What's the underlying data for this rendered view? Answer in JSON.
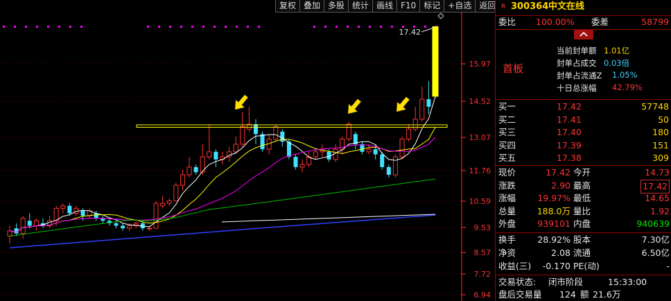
{
  "toolbar": {
    "buttons": [
      "复权",
      "叠加",
      "多股",
      "统计",
      "画线",
      "F10",
      "标记",
      "+自选",
      "返回"
    ]
  },
  "chart": {
    "price_labels": [
      "15.97",
      "14.52",
      "13.07",
      "11.76",
      "10.59",
      "9.53",
      "8.57",
      "7.72",
      "6.94"
    ],
    "last_price_label": "17.42",
    "axis_color": "#ff3030",
    "up_color": "#ff3232",
    "down_color": "#40e0ff",
    "limit_up_color": "#ffff00"
  },
  "quote": {
    "badge": "R",
    "code": "300364",
    "name": "中文在线",
    "weibi_label": "委比",
    "weibi_value": "100.00%",
    "weicha_label": "委差",
    "weicha_value": "58799",
    "shoubanc_label": "首板",
    "seal_stats": [
      {
        "label": "当前封单额",
        "value": "1.01亿"
      },
      {
        "label": "封单占成交",
        "value": "0.03倍"
      },
      {
        "label": "封单占流通Z",
        "value": "1.05%"
      },
      {
        "label": "十日总涨幅",
        "value": "42.79%"
      }
    ],
    "bids": [
      {
        "label": "买一",
        "price": "17.42",
        "vol": "57748"
      },
      {
        "label": "买二",
        "price": "17.41",
        "vol": "50"
      },
      {
        "label": "买三",
        "price": "17.40",
        "vol": "180"
      },
      {
        "label": "买四",
        "price": "17.39",
        "vol": "151"
      },
      {
        "label": "买五",
        "price": "17.38",
        "vol": "309"
      }
    ],
    "stats": [
      {
        "l1": "现价",
        "v1": "17.42",
        "c1": "red",
        "l2": "今开",
        "v2": "14.73",
        "c2": "red"
      },
      {
        "l1": "涨跌",
        "v1": "2.90",
        "c1": "red",
        "l2": "最高",
        "v2": "17.42",
        "c2": "red"
      },
      {
        "l1": "涨幅",
        "v1": "19.97%",
        "c1": "red",
        "l2": "最低",
        "v2": "14.65",
        "c2": "red"
      },
      {
        "l1": "总量",
        "v1": "188.0万",
        "c1": "yellow",
        "l2": "量比",
        "v2": "1.92",
        "c2": "red"
      },
      {
        "l1": "外盘",
        "v1": "939101",
        "c1": "red",
        "l2": "内盘",
        "v2": "940639",
        "c2": "green"
      }
    ],
    "stats2": [
      {
        "l1": "换手",
        "v1": "28.92%",
        "l2": "股本",
        "v2": "7.30亿"
      },
      {
        "l1": "净资",
        "v1": "2.08",
        "l2": "流通",
        "v2": "6.50亿"
      },
      {
        "l1": "收益(三)",
        "v1": "-0.170",
        "l2": "PE(动)",
        "v2": "-"
      }
    ],
    "trade_status_label": "交易状态:",
    "trade_status_value": "闭市阶段",
    "trade_time": "15:33:00",
    "after_label": "盘后交易量",
    "after_vol": "124",
    "after_amt_label": "额",
    "after_amt": "21.6万"
  }
}
